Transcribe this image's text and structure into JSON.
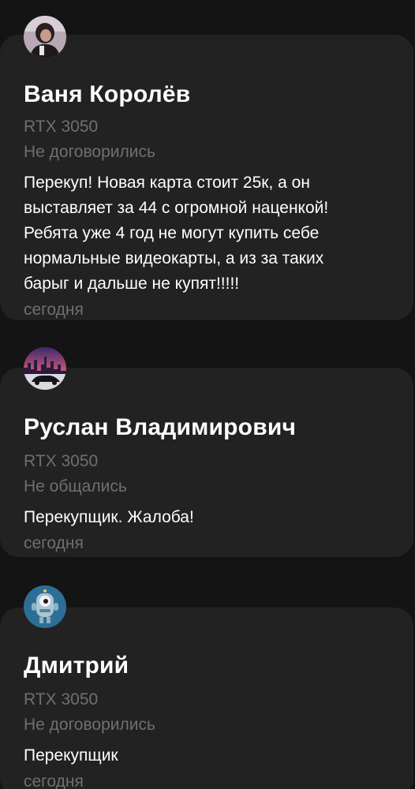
{
  "reviews": [
    {
      "avatar_icon": "user-photo-avatar",
      "name": "Ваня Королёв",
      "product": "RTX 3050",
      "status": "Не договорились",
      "comment_lines": [
        "Перекуп! Новая карта стоит 25к, а он",
        "выставляет за 44 с огромной наценкой!",
        "Ребята уже 4 год не могут купить себе",
        "нормальные видеокарты, а из за таких",
        "барыг и дальше не купят!!!!!"
      ],
      "date": "сегодня"
    },
    {
      "avatar_icon": "city-car-sunset-avatar",
      "name": "Руслан Владимирович",
      "product": "RTX 3050",
      "status": "Не общались",
      "comment_lines": [
        "Перекупщик. Жалоба!"
      ],
      "date": "сегодня"
    },
    {
      "avatar_icon": "robot-avatar",
      "name": "Дмитрий",
      "product": "RTX 3050",
      "status": "Не договорились",
      "comment_lines": [
        "Перекупщик"
      ],
      "date": "сегодня"
    }
  ],
  "colors": {
    "background": "#141414",
    "card": "#222222",
    "secondary_text": "#6f6f6f",
    "primary_text": "#ffffff"
  }
}
